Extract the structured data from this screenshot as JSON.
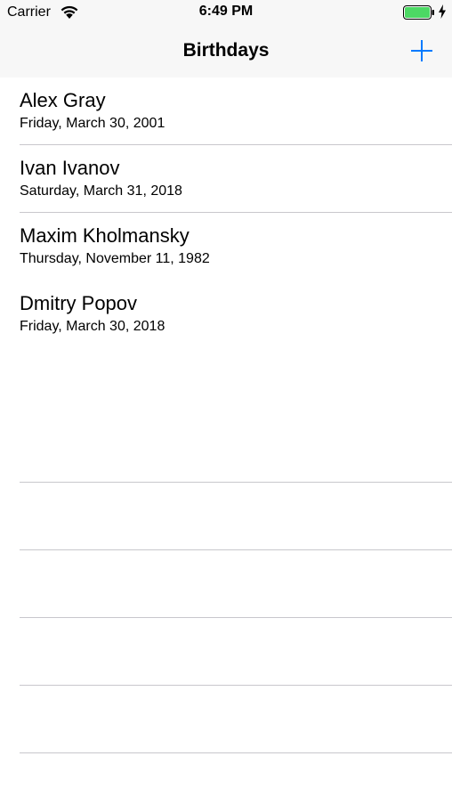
{
  "status_bar": {
    "carrier": "Carrier",
    "time": "6:49 PM",
    "battery_color": "#4cd964",
    "icons": [
      "wifi-icon",
      "battery-icon",
      "charging-bolt-icon"
    ]
  },
  "nav": {
    "title": "Birthdays",
    "add_icon": "plus-icon",
    "accent_color": "#007aff"
  },
  "birthdays": [
    {
      "name": "Alex Gray",
      "date": "Friday, March 30, 2001"
    },
    {
      "name": "Ivan Ivanov",
      "date": "Saturday, March 31, 2018"
    },
    {
      "name": "Maxim Kholmansky",
      "date": "Thursday, November 11, 1982"
    },
    {
      "name": "Dmitry Popov",
      "date": "Friday, March 30, 2018"
    }
  ]
}
